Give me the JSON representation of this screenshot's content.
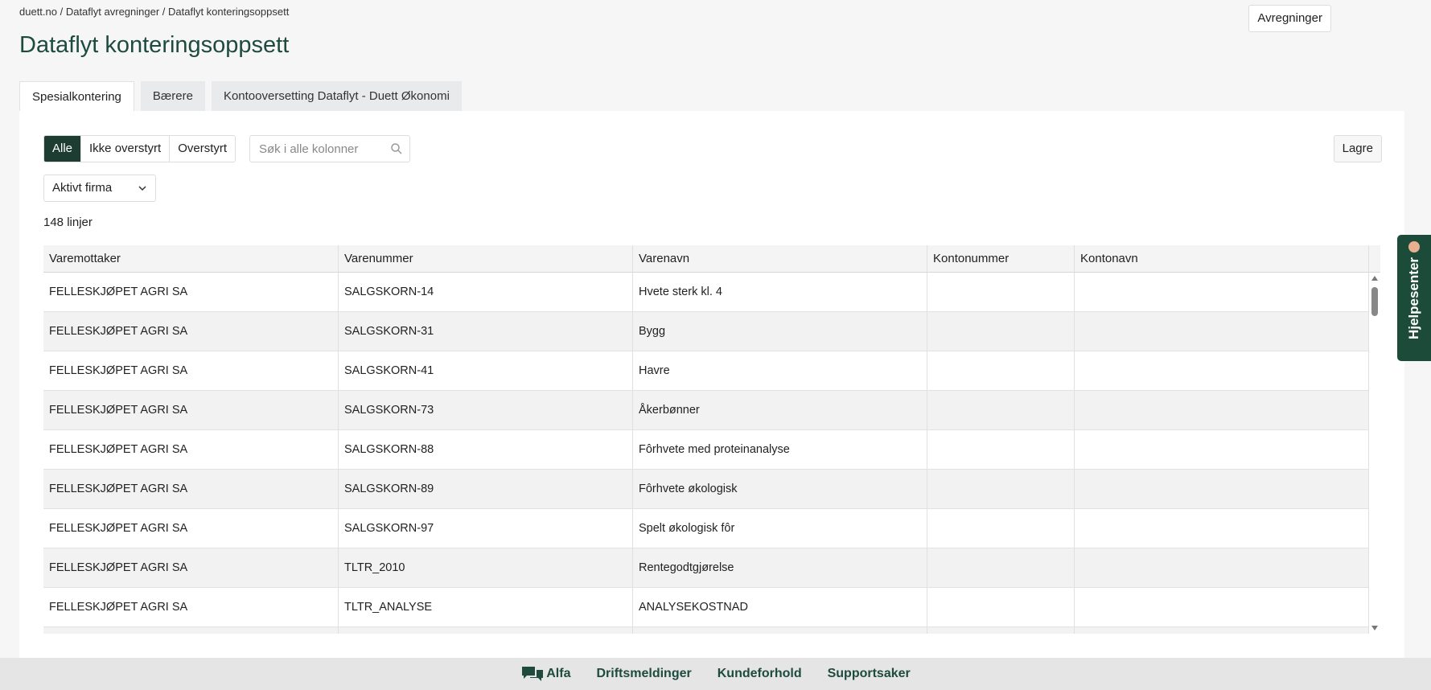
{
  "breadcrumb": "duett.no / Dataflyt avregninger / Dataflyt konteringsoppsett",
  "page_title": "Dataflyt konteringsoppsett",
  "top_button": "Avregninger",
  "tabs": [
    {
      "label": "Spesialkontering"
    },
    {
      "label": "Bærere"
    },
    {
      "label": "Kontooversetting Dataflyt - Duett Økonomi"
    }
  ],
  "filters": [
    {
      "label": "Alle"
    },
    {
      "label": "Ikke overstyrt"
    },
    {
      "label": "Overstyrt"
    }
  ],
  "search": {
    "placeholder": "Søk i alle kolonner",
    "value": ""
  },
  "save_label": "Lagre",
  "company_select": {
    "selected": "Aktivt firma"
  },
  "line_count": "148 linjer",
  "columns": [
    "Varemottaker",
    "Varenummer",
    "Varenavn",
    "Kontonummer",
    "Kontonavn"
  ],
  "rows": [
    [
      "FELLESKJØPET AGRI SA",
      "SALGSKORN-14",
      "Hvete sterk kl. 4",
      "",
      ""
    ],
    [
      "FELLESKJØPET AGRI SA",
      "SALGSKORN-31",
      "Bygg",
      "",
      ""
    ],
    [
      "FELLESKJØPET AGRI SA",
      "SALGSKORN-41",
      "Havre",
      "",
      ""
    ],
    [
      "FELLESKJØPET AGRI SA",
      "SALGSKORN-73",
      "Åkerbønner",
      "",
      ""
    ],
    [
      "FELLESKJØPET AGRI SA",
      "SALGSKORN-88",
      "Fôrhvete med proteinanalyse",
      "",
      ""
    ],
    [
      "FELLESKJØPET AGRI SA",
      "SALGSKORN-89",
      "Fôrhvete økologisk",
      "",
      ""
    ],
    [
      "FELLESKJØPET AGRI SA",
      "SALGSKORN-97",
      "Spelt økologisk fôr",
      "",
      ""
    ],
    [
      "FELLESKJØPET AGRI SA",
      "TLTR_2010",
      "Rentegodtgjørelse",
      "",
      ""
    ],
    [
      "FELLESKJØPET AGRI SA",
      "TLTR_ANALYSE",
      "ANALYSEKOSTNAD",
      "",
      ""
    ],
    [
      "",
      "",
      "",
      "",
      ""
    ]
  ],
  "help_label": "Hjelpesenter",
  "footer_links": [
    {
      "label": "Alfa",
      "icon": "chat-icon"
    },
    {
      "label": "Driftsmeldinger"
    },
    {
      "label": "Kundeforhold"
    },
    {
      "label": "Supportsaker"
    }
  ],
  "colors": {
    "brand": "#1e4b3e",
    "active_filter": "#1d3d33"
  }
}
